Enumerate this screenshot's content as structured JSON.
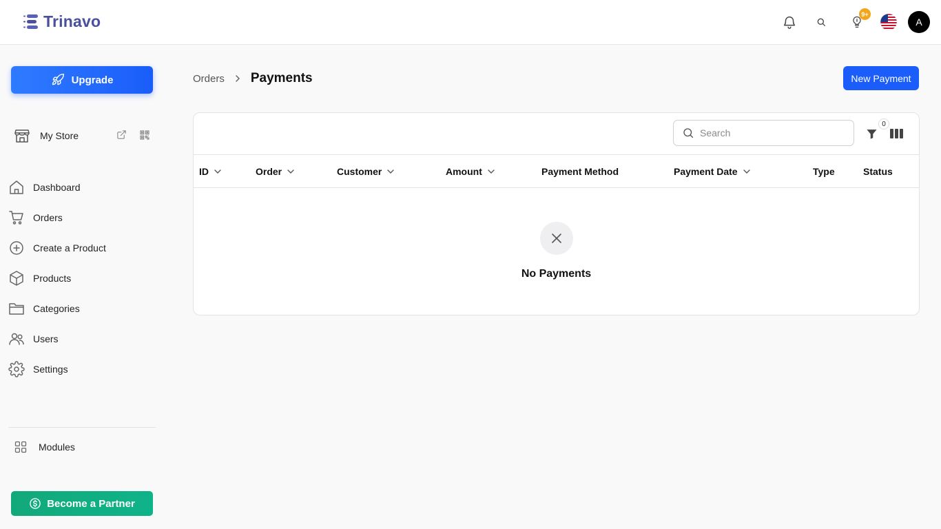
{
  "app": {
    "name": "Trinavo"
  },
  "topbar": {
    "notification_badge": "9+",
    "avatar_initial": "A"
  },
  "sidebar": {
    "upgrade_label": "Upgrade",
    "store_label": "My Store",
    "nav": [
      {
        "label": "Dashboard"
      },
      {
        "label": "Orders"
      },
      {
        "label": "Create a Product"
      },
      {
        "label": "Products"
      },
      {
        "label": "Categories"
      },
      {
        "label": "Users"
      },
      {
        "label": "Settings"
      }
    ],
    "modules_label": "Modules",
    "partner_label": "Become a Partner"
  },
  "breadcrumb": {
    "parent": "Orders",
    "current": "Payments"
  },
  "actions": {
    "new_payment_label": "New Payment"
  },
  "table": {
    "search_placeholder": "Search",
    "filter_count": "0",
    "columns": [
      {
        "label": "ID"
      },
      {
        "label": "Order"
      },
      {
        "label": "Customer"
      },
      {
        "label": "Amount"
      },
      {
        "label": "Payment Method"
      },
      {
        "label": "Payment Date"
      },
      {
        "label": "Type"
      },
      {
        "label": "Status"
      }
    ],
    "empty_text": "No Payments"
  },
  "colors": {
    "primary": "#1a5dfa",
    "partner": "#12a97a",
    "brand": "#4a4f9e",
    "badge": "#f3a51c"
  }
}
